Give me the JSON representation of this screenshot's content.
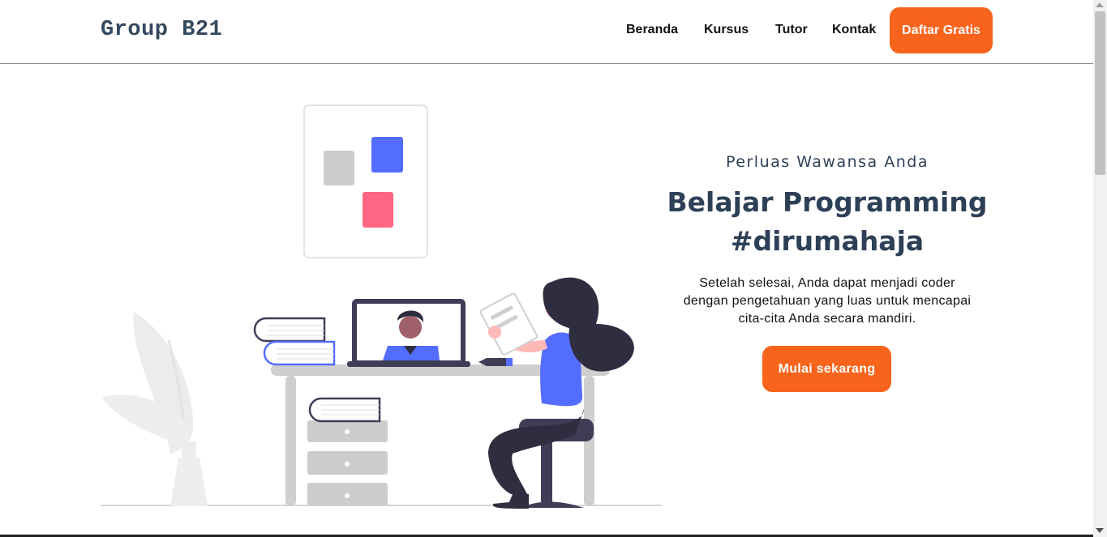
{
  "header": {
    "brand": "Group B21",
    "nav": [
      "Beranda",
      "Kursus",
      "Tutor",
      "Kontak"
    ],
    "cta": "Daftar Gratis"
  },
  "hero": {
    "subtitle": "Perluas Wawansa Anda",
    "title_line1": "Belajar Programming",
    "title_line2": "#dirumahaja",
    "description_line1": "Setelah selesai, Anda dapat menjadi coder",
    "description_line2": "dengan pengetahuan yang luas untuk mencapai",
    "description_line3": "cita-cita Anda secara mandiri.",
    "cta": "Mulai sekarang"
  },
  "colors": {
    "accent": "#f8641c",
    "heading": "#2e4057",
    "illustration_blue": "#536dfe",
    "illustration_pink": "#ff6584",
    "illustration_dark": "#2f2e41"
  },
  "illustration": {
    "name": "online-learning-illustration"
  }
}
